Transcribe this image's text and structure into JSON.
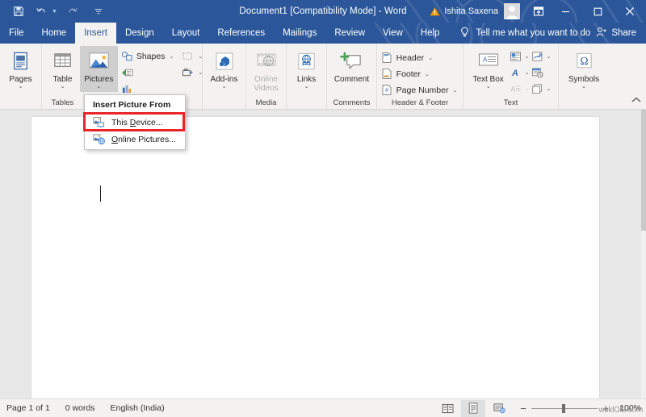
{
  "titlebar": {
    "quick_access": [
      {
        "name": "save",
        "label": "Save"
      },
      {
        "name": "undo",
        "label": "Undo"
      },
      {
        "name": "redo",
        "label": "Redo"
      },
      {
        "name": "customize",
        "label": "Customize Quick Access Toolbar"
      }
    ],
    "title": "Document1 [Compatibility Mode]  -  Word",
    "account_name": "Ishita Saxena",
    "warning_icon": "warning-triangle-icon",
    "ribbon_display_label": "Ribbon Display Options",
    "minimize_label": "Minimize",
    "restore_label": "Restore Down",
    "close_label": "Close",
    "brand_color": "#2b579a"
  },
  "tabs": [
    {
      "label": "File",
      "active": false
    },
    {
      "label": "Home",
      "active": false
    },
    {
      "label": "Insert",
      "active": true
    },
    {
      "label": "Design",
      "active": false
    },
    {
      "label": "Layout",
      "active": false
    },
    {
      "label": "References",
      "active": false
    },
    {
      "label": "Mailings",
      "active": false
    },
    {
      "label": "Review",
      "active": false
    },
    {
      "label": "View",
      "active": false
    },
    {
      "label": "Help",
      "active": false
    }
  ],
  "tellme": {
    "placeholder": "Tell me what you want to do",
    "icon": "lightbulb-icon"
  },
  "share": {
    "label": "Share",
    "icon": "share-person-icon"
  },
  "ribbon": {
    "groups": [
      {
        "name": "pages",
        "label": "",
        "buttons": [
          {
            "label": "Pages",
            "caret": true,
            "icon": "pages-icon"
          }
        ]
      },
      {
        "name": "tables",
        "label": "Tables",
        "buttons": [
          {
            "label": "Table",
            "caret": true,
            "icon": "table-icon"
          }
        ]
      },
      {
        "name": "illustrations",
        "label": "",
        "buttons": [
          {
            "label": "Pictures",
            "caret": true,
            "icon": "pictures-icon",
            "active": true
          }
        ],
        "small_items": [
          {
            "label": "Shapes",
            "icon": "shapes-icon",
            "caret": true
          },
          {
            "label": "",
            "icon": "smartart-icon",
            "caret": false
          },
          {
            "label": "",
            "icon": "chart-icon",
            "caret": false
          }
        ],
        "extra_items": [
          {
            "label": "",
            "icon": "icons-gallery-icon",
            "caret": true
          },
          {
            "label": "",
            "icon": "screenshot-icon",
            "caret": true
          }
        ]
      },
      {
        "name": "add-ins",
        "label": "",
        "buttons": [
          {
            "label": "Add-ins",
            "caret": true,
            "icon": "addins-icon"
          }
        ]
      },
      {
        "name": "media",
        "label": "Media",
        "buttons": [
          {
            "label": "Online Videos",
            "caret": false,
            "icon": "online-videos-icon",
            "disabled": true
          }
        ]
      },
      {
        "name": "links",
        "label": "",
        "buttons": [
          {
            "label": "Links",
            "caret": true,
            "icon": "links-icon"
          }
        ]
      },
      {
        "name": "comments",
        "label": "Comments",
        "buttons": [
          {
            "label": "Comment",
            "caret": false,
            "icon": "new-comment-icon"
          }
        ]
      },
      {
        "name": "header-footer",
        "label": "Header & Footer",
        "small_items": [
          {
            "label": "Header",
            "icon": "header-icon",
            "caret": true
          },
          {
            "label": "Footer",
            "icon": "footer-icon",
            "caret": true
          },
          {
            "label": "Page Number",
            "icon": "page-number-icon",
            "caret": true
          }
        ]
      },
      {
        "name": "text",
        "label": "Text",
        "buttons": [
          {
            "label": "Text Box",
            "caret": true,
            "icon": "text-box-icon"
          }
        ],
        "grid_items": [
          {
            "icon": "quick-parts-icon",
            "caret": true
          },
          {
            "icon": "signature-line-icon",
            "caret": true
          },
          {
            "icon": "wordart-icon",
            "caret": true
          },
          {
            "icon": "date-time-icon",
            "caret": false
          },
          {
            "icon": "drop-cap-icon",
            "caret": true
          },
          {
            "icon": "object-icon",
            "caret": true
          }
        ]
      },
      {
        "name": "symbols",
        "label": "",
        "buttons": [
          {
            "label": "Symbols",
            "caret": true,
            "icon": "omega-symbol-icon"
          }
        ]
      }
    ],
    "collapse_label": "Collapse the Ribbon"
  },
  "menu": {
    "header": "Insert Picture From",
    "items": [
      {
        "label_pre": "This ",
        "accel": "D",
        "label_post": "evice...",
        "icon": "this-device-icon",
        "highlighted": true
      },
      {
        "label_pre": "",
        "accel": "O",
        "label_post": "nline Pictures...",
        "icon": "online-pictures-icon",
        "highlighted": false
      }
    ],
    "highlight_color": "#e8262a"
  },
  "statusbar": {
    "page_info": "Page 1 of 1",
    "word_count": "0 words",
    "language": "English (India)",
    "views": [
      {
        "name": "read-mode",
        "label": "Read Mode",
        "active": false
      },
      {
        "name": "print-layout",
        "label": "Print Layout",
        "active": true
      },
      {
        "name": "web-layout",
        "label": "Web Layout",
        "active": false
      }
    ],
    "zoom_out": "−",
    "zoom_in": "+",
    "zoom_percent": "100%",
    "watermark": "wsklOl3.com"
  }
}
